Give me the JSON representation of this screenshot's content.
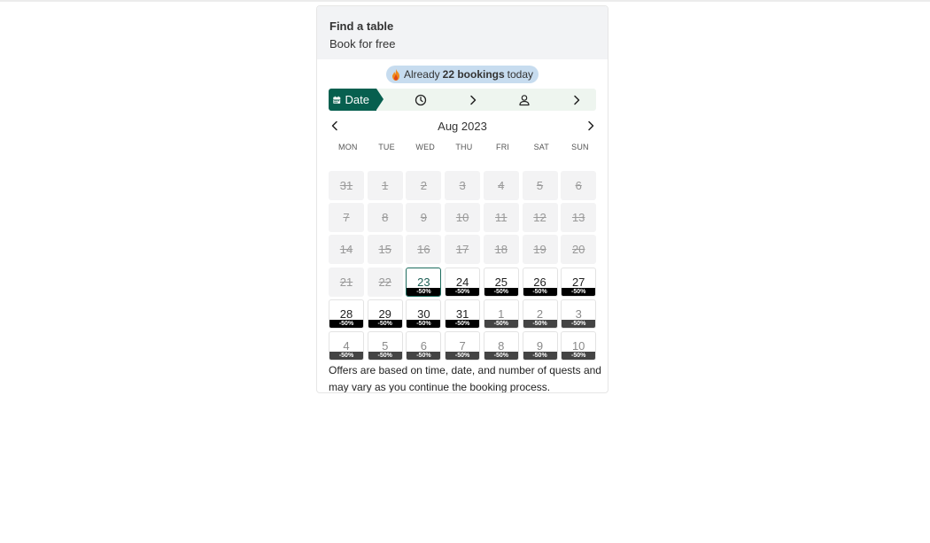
{
  "header": {
    "title": "Find a table",
    "subtitle": "Book for free"
  },
  "badge": {
    "prefix": "Already",
    "count_text": "22 bookings",
    "suffix": "today"
  },
  "steps": {
    "date_label": "Date"
  },
  "calendar": {
    "month_label": "Aug 2023",
    "weekdays": [
      "MON",
      "TUE",
      "WED",
      "THU",
      "FRI",
      "SAT",
      "SUN"
    ],
    "discount_label": "-50%",
    "days": [
      {
        "d": "31",
        "s": "past"
      },
      {
        "d": "1",
        "s": "past"
      },
      {
        "d": "2",
        "s": "past"
      },
      {
        "d": "3",
        "s": "past"
      },
      {
        "d": "4",
        "s": "past"
      },
      {
        "d": "5",
        "s": "past"
      },
      {
        "d": "6",
        "s": "past"
      },
      {
        "d": "7",
        "s": "past"
      },
      {
        "d": "8",
        "s": "past"
      },
      {
        "d": "9",
        "s": "past"
      },
      {
        "d": "10",
        "s": "past"
      },
      {
        "d": "11",
        "s": "past"
      },
      {
        "d": "12",
        "s": "past"
      },
      {
        "d": "13",
        "s": "past"
      },
      {
        "d": "14",
        "s": "past"
      },
      {
        "d": "15",
        "s": "past"
      },
      {
        "d": "16",
        "s": "past"
      },
      {
        "d": "17",
        "s": "past"
      },
      {
        "d": "18",
        "s": "past"
      },
      {
        "d": "19",
        "s": "past"
      },
      {
        "d": "20",
        "s": "past"
      },
      {
        "d": "21",
        "s": "past"
      },
      {
        "d": "22",
        "s": "past"
      },
      {
        "d": "23",
        "s": "selected"
      },
      {
        "d": "24",
        "s": "avail"
      },
      {
        "d": "25",
        "s": "avail"
      },
      {
        "d": "26",
        "s": "avail"
      },
      {
        "d": "27",
        "s": "avail"
      },
      {
        "d": "28",
        "s": "avail"
      },
      {
        "d": "29",
        "s": "avail"
      },
      {
        "d": "30",
        "s": "avail"
      },
      {
        "d": "31",
        "s": "avail"
      },
      {
        "d": "1",
        "s": "next"
      },
      {
        "d": "2",
        "s": "next"
      },
      {
        "d": "3",
        "s": "next"
      },
      {
        "d": "4",
        "s": "next"
      },
      {
        "d": "5",
        "s": "next"
      },
      {
        "d": "6",
        "s": "next"
      },
      {
        "d": "7",
        "s": "next"
      },
      {
        "d": "8",
        "s": "next"
      },
      {
        "d": "9",
        "s": "next"
      },
      {
        "d": "10",
        "s": "next"
      }
    ]
  },
  "note": "Offers are based on time, date, and number of quests and may vary as you continue the booking process.",
  "colors": {
    "brand": "#075f4f",
    "badge_bg": "#c7dcef",
    "steps_bg": "#eef5ef",
    "discount": "#000000"
  }
}
